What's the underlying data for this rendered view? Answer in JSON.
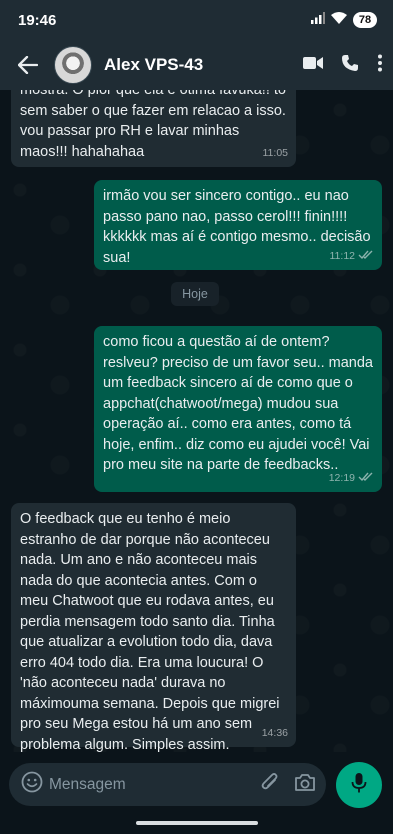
{
  "status_bar": {
    "time": "19:46",
    "battery": "78"
  },
  "header": {
    "contact_name": "Alex VPS-43"
  },
  "date_separator": "Hoje",
  "messages": [
    {
      "direction": "in",
      "text": "mostra. O pior que ela é ótima favuka!! to sem saber o que fazer em relacao a isso. vou passar pro RH e lavar minhas maos!!! hahahahaa",
      "time": "11:05"
    },
    {
      "direction": "out",
      "text": "irmão vou ser sincero contigo.. eu nao passo pano nao, passo cerol!!! finin!!!! kkkkkk mas aí é contigo mesmo.. decisão sua!",
      "time": "11:12"
    },
    {
      "direction": "out",
      "text": "como ficou a questão aí de ontem? reslveu? preciso de um favor seu.. manda um feedback sincero aí de como que o appchat(chatwoot/mega) mudou sua operação aí.. como era antes, como tá hoje, enfim.. diz como eu ajudei você! Vai pro meu site na parte de feedbacks..",
      "time": "12:19"
    },
    {
      "direction": "in",
      "text": "O feedback que eu tenho é meio estranho de dar porque não aconteceu nada. Um ano e não aconteceu mais nada do que acontecia antes. Com o meu Chatwoot que eu rodava antes, eu perdia mensagem todo santo dia. Tinha que atualizar a evolution todo dia, dava erro 404 todo dia. Era uma loucura! O 'não aconteceu nada' durava no máximouma semana. Depois que migrei pro seu Mega estou há um ano sem problema algum. Simples assim.",
      "time": "14:36"
    }
  ],
  "composer": {
    "placeholder": "Mensagem"
  },
  "colors": {
    "incoming": "#202c33",
    "outgoing": "#005c4b",
    "accent": "#00a884",
    "background": "#0b141a",
    "header": "#1f2c34"
  }
}
